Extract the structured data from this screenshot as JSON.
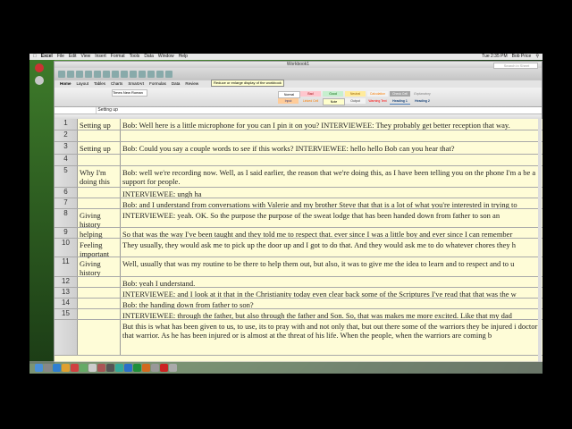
{
  "menubar": {
    "app": "Excel",
    "items": [
      "File",
      "Edit",
      "View",
      "Insert",
      "Format",
      "Tools",
      "Data",
      "Window",
      "Help"
    ],
    "clock": "Tue 2:35 PM",
    "user": "Bob Price"
  },
  "window": {
    "title": "Workbook1",
    "search_placeholder": "Search in Sheet"
  },
  "tooltip": "Reduce or enlarge display of the workbook",
  "ribbon_tabs": [
    "Home",
    "Layout",
    "Tables",
    "Charts",
    "SmartArt",
    "Formulas",
    "Data",
    "Review"
  ],
  "ribbon": {
    "font_name": "Times New Roman",
    "styles": [
      "Normal",
      "Bad",
      "Good",
      "Neutral",
      "Calculation",
      "Check Cell",
      "Explanatory",
      "Input",
      "Linked Cell",
      "Note",
      "Output",
      "Warning Text",
      "Heading 1",
      "Heading 2"
    ]
  },
  "formula_bar": {
    "value": "Setting up"
  },
  "rows": [
    {
      "num": "1",
      "a": "Setting up",
      "b": "Bob: Well here is a little microphone for you can I pin it on you? INTERVIEWEE:  They probably get better reception that way."
    },
    {
      "num": "2",
      "a": "",
      "b": ""
    },
    {
      "num": "3",
      "a": "Setting up",
      "b": "Bob:  Could you say a couple words to see if this works? INTERVIEWEE:  hello hello Bob can you hear that?"
    },
    {
      "num": "4",
      "a": "",
      "b": ""
    },
    {
      "num": "5",
      "a": "Why I'm doing this",
      "b": "Bob:  well we're recording now.  Well, as I said earlier, the reason that we're doing this, as I have been telling you on the phone I'm a be a support for people."
    },
    {
      "num": "6",
      "a": "",
      "b": "INTERVIEWEE:  ungh ha"
    },
    {
      "num": "7",
      "a": "",
      "b": "Bob:  and I understand from conversations with Valerie and my brother Steve that that is a lot of what you're interested in trying to"
    },
    {
      "num": "8",
      "a": "Giving history",
      "b": "INTERVIEWEE:  yeah.  OK.  So the purpose the purpose of the sweat lodge that has been handed down from father to son an"
    },
    {
      "num": "9",
      "a": "helping",
      "b": "So that was the way I've been taught and they told me to respect that.  ever since I was a little boy and ever since I can remember"
    },
    {
      "num": "10",
      "a": "Feeling important",
      "b": "They usually, they would ask me to pick up the door up and I got to do that.  And they would ask me to do whatever chores they h"
    },
    {
      "num": "11",
      "a": "Giving history",
      "b": "Well, usually that was my routine to be there to help them out, but also, it was to give me the idea to learn and to respect and to u"
    },
    {
      "num": "12",
      "a": "",
      "b": "Bob:  yeah I understand."
    },
    {
      "num": "13",
      "a": "",
      "b": "INTERVIEWEE:  and I look at it that in the Christianity today even clear back some of the Scriptures I've read that that was the w"
    },
    {
      "num": "14",
      "a": "",
      "b": "Bob:  the handing down from father to son?"
    },
    {
      "num": "15",
      "a": "",
      "b": "INTERVIEWEE:  through the father, but also through the father and Son.  So, that was makes me more excited.  Like that my dad"
    },
    {
      "num": "",
      "a": "",
      "b": "But this is what has been given to us, to use, its to pray with and not only that, but out there some of the warriors they be injured i doctor that warrior.  As he has been injured or is almost at the threat of his life.  When the people, when the warriors are coming b"
    }
  ],
  "colors": {
    "cell_bg": "#fefcd7",
    "accent": "#3d7a2a"
  }
}
